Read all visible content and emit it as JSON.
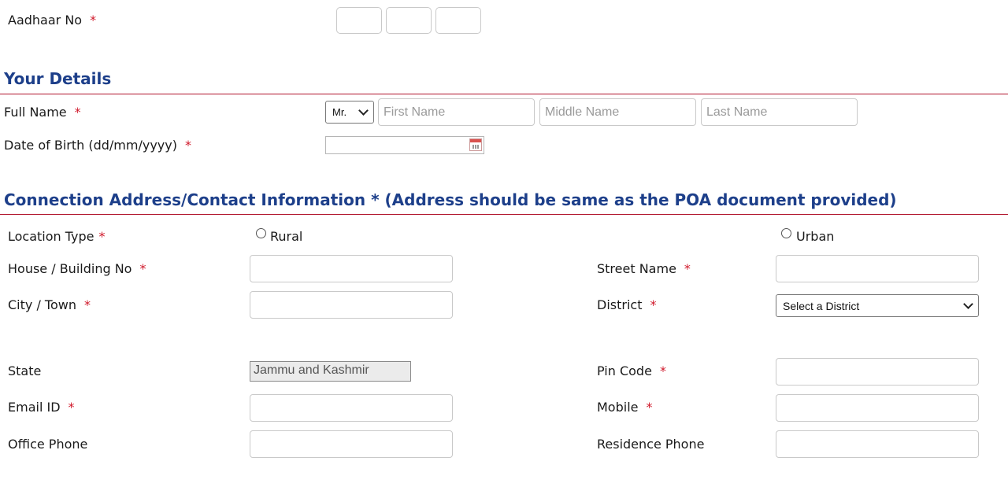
{
  "aadhaar": {
    "label": "Aadhaar No",
    "required": "*"
  },
  "your_details": {
    "heading": "Your Details",
    "full_name": {
      "label": "Full Name",
      "required": "*",
      "title_select": "Mr.",
      "first_placeholder": "First Name",
      "middle_placeholder": "Middle Name",
      "last_placeholder": "Last Name"
    },
    "dob": {
      "label": "Date of Birth (dd/mm/yyyy)",
      "required": "*"
    }
  },
  "address": {
    "heading": "Connection Address/Contact Information * (Address should be same as the POA document provided)",
    "location_type": {
      "label": "Location Type",
      "required": "*",
      "rural": "Rural",
      "urban": "Urban"
    },
    "house": {
      "label": "House / Building No",
      "required": "*"
    },
    "street": {
      "label": "Street Name",
      "required": "*"
    },
    "city": {
      "label": "City / Town",
      "required": "*"
    },
    "district": {
      "label": "District",
      "required": "*",
      "selected": "Select a District"
    },
    "state": {
      "label": "State",
      "value": "Jammu and Kashmir"
    },
    "pin": {
      "label": "Pin Code",
      "required": "*"
    },
    "email": {
      "label": "Email ID",
      "required": "*"
    },
    "mobile": {
      "label": "Mobile",
      "required": "*"
    },
    "office_phone": {
      "label": "Office Phone"
    },
    "residence_phone": {
      "label": "Residence Phone"
    }
  }
}
